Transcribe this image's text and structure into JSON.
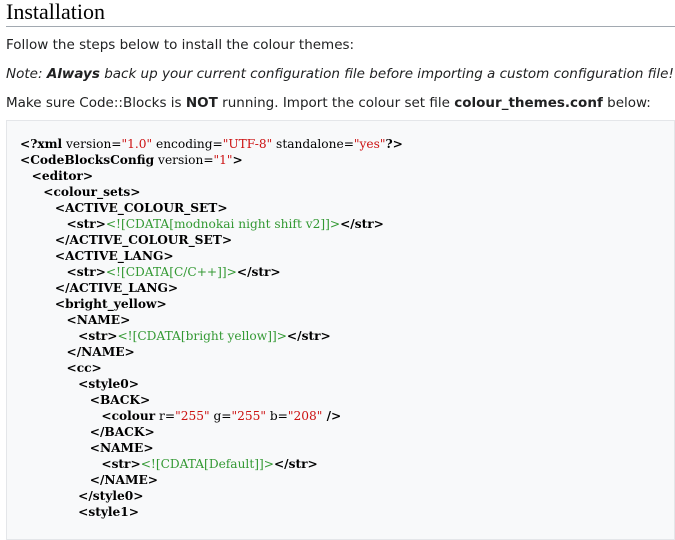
{
  "section": {
    "title": "Installation"
  },
  "intro": "Follow the steps below to install the colour themes:",
  "note": {
    "label": "Note:",
    "emphasis": "Always",
    "text": "back up your current configuration file before importing a custom configuration file!"
  },
  "instruction": {
    "before_app": "Make sure ",
    "app": "Code::Blocks",
    "is": " is ",
    "not": "NOT",
    "middle": " running. Import the colour set file ",
    "file": "colour_themes.conf",
    "after": " below:"
  },
  "code_lines": [
    {
      "indent": "",
      "parts": [
        {
          "t": "<?xml",
          "c": "tg"
        },
        {
          "t": " version=",
          "c": "at"
        },
        {
          "t": "\"1.0\"",
          "c": "vl"
        },
        {
          "t": " encoding=",
          "c": "at"
        },
        {
          "t": "\"UTF-8\"",
          "c": "vl"
        },
        {
          "t": " standalone=",
          "c": "at"
        },
        {
          "t": "\"yes\"",
          "c": "vl"
        },
        {
          "t": "?>",
          "c": "tg"
        }
      ]
    },
    {
      "indent": "",
      "parts": [
        {
          "t": "<CodeBlocksConfig",
          "c": "tg"
        },
        {
          "t": " version=",
          "c": "at"
        },
        {
          "t": "\"1\"",
          "c": "vl"
        },
        {
          "t": ">",
          "c": "tg"
        }
      ]
    },
    {
      "indent": "   ",
      "parts": [
        {
          "t": "<editor>",
          "c": "tg"
        }
      ]
    },
    {
      "indent": "      ",
      "parts": [
        {
          "t": "<colour_sets>",
          "c": "tg"
        }
      ]
    },
    {
      "indent": "         ",
      "parts": [
        {
          "t": "<ACTIVE_COLOUR_SET>",
          "c": "tg"
        }
      ]
    },
    {
      "indent": "            ",
      "parts": [
        {
          "t": "<str>",
          "c": "tg"
        },
        {
          "t": "<![CDATA[modnokai night shift v2]]>",
          "c": "cd"
        },
        {
          "t": "</str>",
          "c": "tg"
        }
      ]
    },
    {
      "indent": "         ",
      "parts": [
        {
          "t": "</ACTIVE_COLOUR_SET>",
          "c": "tg"
        }
      ]
    },
    {
      "indent": "         ",
      "parts": [
        {
          "t": "<ACTIVE_LANG>",
          "c": "tg"
        }
      ]
    },
    {
      "indent": "            ",
      "parts": [
        {
          "t": "<str>",
          "c": "tg"
        },
        {
          "t": "<![CDATA[C/C++]]>",
          "c": "cd"
        },
        {
          "t": "</str>",
          "c": "tg"
        }
      ]
    },
    {
      "indent": "         ",
      "parts": [
        {
          "t": "</ACTIVE_LANG>",
          "c": "tg"
        }
      ]
    },
    {
      "indent": "         ",
      "parts": [
        {
          "t": "<bright_yellow>",
          "c": "tg"
        }
      ]
    },
    {
      "indent": "            ",
      "parts": [
        {
          "t": "<NAME>",
          "c": "tg"
        }
      ]
    },
    {
      "indent": "               ",
      "parts": [
        {
          "t": "<str>",
          "c": "tg"
        },
        {
          "t": "<![CDATA[bright yellow]]>",
          "c": "cd"
        },
        {
          "t": "</str>",
          "c": "tg"
        }
      ]
    },
    {
      "indent": "            ",
      "parts": [
        {
          "t": "</NAME>",
          "c": "tg"
        }
      ]
    },
    {
      "indent": "            ",
      "parts": [
        {
          "t": "<cc>",
          "c": "tg"
        }
      ]
    },
    {
      "indent": "               ",
      "parts": [
        {
          "t": "<style0>",
          "c": "tg"
        }
      ]
    },
    {
      "indent": "                  ",
      "parts": [
        {
          "t": "<BACK>",
          "c": "tg"
        }
      ]
    },
    {
      "indent": "                     ",
      "parts": [
        {
          "t": "<colour",
          "c": "tg"
        },
        {
          "t": " r=",
          "c": "at"
        },
        {
          "t": "\"255\"",
          "c": "vl"
        },
        {
          "t": " g=",
          "c": "at"
        },
        {
          "t": "\"255\"",
          "c": "vl"
        },
        {
          "t": " b=",
          "c": "at"
        },
        {
          "t": "\"208\"",
          "c": "vl"
        },
        {
          "t": " />",
          "c": "tg"
        }
      ]
    },
    {
      "indent": "                  ",
      "parts": [
        {
          "t": "</BACK>",
          "c": "tg"
        }
      ]
    },
    {
      "indent": "                  ",
      "parts": [
        {
          "t": "<NAME>",
          "c": "tg"
        }
      ]
    },
    {
      "indent": "                     ",
      "parts": [
        {
          "t": "<str>",
          "c": "tg"
        },
        {
          "t": "<![CDATA[Default]]>",
          "c": "cd"
        },
        {
          "t": "</str>",
          "c": "tg"
        }
      ]
    },
    {
      "indent": "                  ",
      "parts": [
        {
          "t": "</NAME>",
          "c": "tg"
        }
      ]
    },
    {
      "indent": "               ",
      "parts": [
        {
          "t": "</style0>",
          "c": "tg"
        }
      ]
    },
    {
      "indent": "               ",
      "parts": [
        {
          "t": "<style1>",
          "c": "tg"
        }
      ]
    }
  ]
}
